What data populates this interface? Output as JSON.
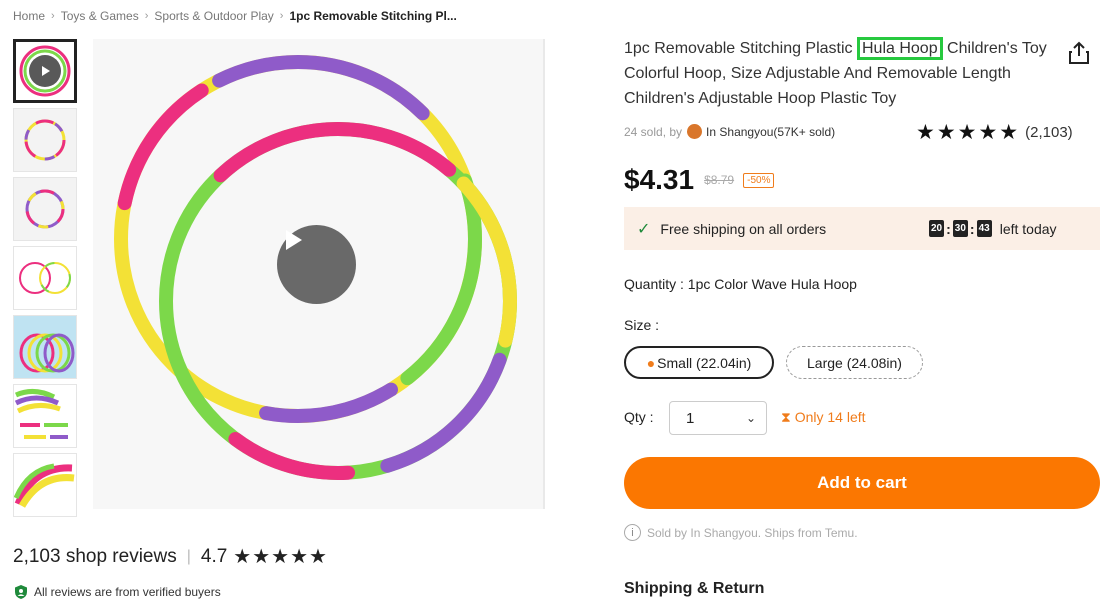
{
  "breadcrumb": [
    "Home",
    "Toys & Games",
    "Sports & Outdoor Play",
    "1pc Removable Stitching Pl..."
  ],
  "breadcrumb_separator": "›",
  "gallery": {
    "thumbnails": [
      "video",
      "hoop-1",
      "hoop-2",
      "hoop-pair",
      "hoop-stack",
      "hoop-pieces",
      "hoop-arc"
    ]
  },
  "product": {
    "title_before": "1pc Removable Stitching Plastic ",
    "title_highlight": "Hula Hoop",
    "title_after": " Children's Toy Colorful Hoop, Size Adjustable And Removable Length Children's Adjustable Hoop Plastic Toy",
    "sold_text": "24 sold, by",
    "seller": "In Shangyou(57K+ sold)",
    "rating_stars": "★★★★★",
    "rating_count": "(2,103)",
    "price": "$4.31",
    "old_price": "$8.79",
    "discount": "-50%"
  },
  "shipping": {
    "check_icon": "✓",
    "text": "Free shipping on all orders",
    "timer": [
      "20",
      "30",
      "43"
    ],
    "left_today": "left today"
  },
  "options": {
    "quantity_label": "Quantity : 1pc Color Wave Hula Hoop",
    "size_label": "Size :",
    "sizes": [
      "Small (22.04in)",
      "Large (24.08in)"
    ],
    "qty_label": "Qty :",
    "qty_value": "1",
    "only_left": "Only 14 left"
  },
  "actions": {
    "add_to_cart": "Add to cart",
    "sold_by_note": "Sold by In Shangyou. Ships from Temu."
  },
  "reviews": {
    "count_text": "2,103 shop reviews",
    "score": "4.7",
    "stars": "★★★★★",
    "verified": "All reviews are from verified buyers"
  },
  "sections": {
    "shipping_return": "Shipping & Return"
  },
  "colors": {
    "accent": "#fb7701",
    "highlight_box": "#27c93f",
    "hoop_pink": "#ec2f7f",
    "hoop_yellow": "#f3e136",
    "hoop_green": "#7cd84a",
    "hoop_purple": "#8f5bc9"
  }
}
